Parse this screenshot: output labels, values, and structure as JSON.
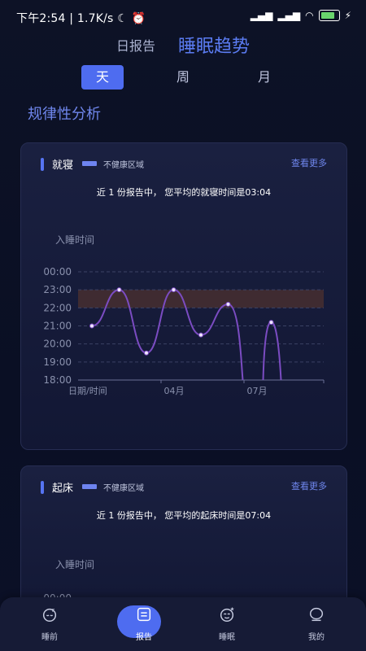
{
  "status": {
    "time": "下午2:54",
    "speed": "1.7K/s",
    "battery": "77"
  },
  "header": {
    "tab_daily": "日报告",
    "tab_trend": "睡眠趋势"
  },
  "range": {
    "day": "天",
    "week": "周",
    "month": "月",
    "selected": "天"
  },
  "section_title": "规律性分析",
  "cards": [
    {
      "title": "就寝",
      "legend": "不健康区域",
      "more": "查看更多",
      "summary": "近 1 份报告中， 您平均的就寝时间是03:04",
      "y_axis_title": "入睡时间"
    },
    {
      "title": "起床",
      "legend": "不健康区域",
      "more": "查看更多",
      "summary": "近 1 份报告中， 您平均的起床时间是07:04",
      "y_axis_title": "入睡时间"
    }
  ],
  "chart_data": {
    "type": "line",
    "y_ticks": [
      "00:00",
      "23:00",
      "22:00",
      "21:00",
      "20:00",
      "19:00",
      "18:00"
    ],
    "y_values": [
      24,
      23,
      22,
      21,
      20,
      19,
      18
    ],
    "x_ticks": [
      "日期/时间",
      "04月",
      "07月"
    ],
    "unhealthy_band": [
      22,
      23
    ],
    "series": [
      {
        "points": [
          {
            "x": 0,
            "y": 21.0
          },
          {
            "x": 1,
            "y": 23.0
          },
          {
            "x": 2,
            "y": 19.5
          },
          {
            "x": 3,
            "y": 23.0
          },
          {
            "x": 4,
            "y": 20.5
          },
          {
            "x": 5,
            "y": 22.2
          },
          {
            "x": 7,
            "y": 21.2
          }
        ]
      }
    ],
    "second_y_ticks": [
      "00:00"
    ],
    "accent_color": "#6f86ec",
    "line_color": "#7b4cc2",
    "band_color": "#4a3030"
  },
  "tabbar": {
    "items": [
      {
        "label": "睡前",
        "icon": "sleep-face-icon"
      },
      {
        "label": "报告",
        "icon": "report-icon"
      },
      {
        "label": "睡眠",
        "icon": "moon-face-icon"
      },
      {
        "label": "我的",
        "icon": "user-icon"
      }
    ],
    "active": "报告"
  }
}
